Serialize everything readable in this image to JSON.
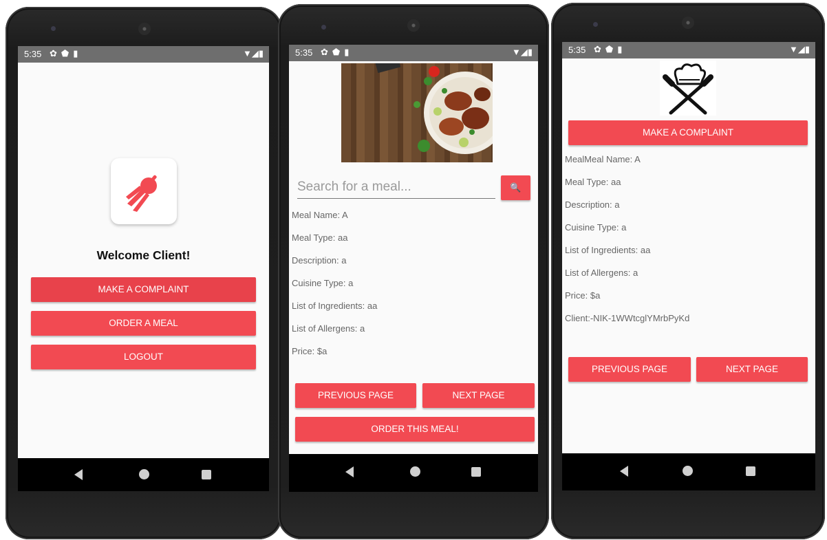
{
  "status": {
    "time": "5:35",
    "left_icons": [
      "gear-icon",
      "shield-icon",
      "sdcard-icon"
    ],
    "right_icons": [
      "wifi-icon",
      "signal-icon",
      "battery-icon"
    ]
  },
  "colors": {
    "accent": "#f24a52",
    "accent_dark": "#e8424b",
    "statusbar": "#6e6e6e",
    "screen_bg": "#fafafa"
  },
  "screen1": {
    "logo_icon": "delivery-rocket-icon",
    "welcome": "Welcome Client!",
    "buttons": {
      "complaint": "MAKE A COMPLAINT",
      "order": "ORDER A MEAL",
      "logout": "LOGOUT"
    }
  },
  "screen2": {
    "image_alt": "roasted chicken dish",
    "search": {
      "placeholder": "Search for a meal...",
      "icon": "search-icon"
    },
    "fields": [
      "Meal Name: A",
      "Meal Type: aa",
      " Description: a",
      " Cuisine Type: a",
      " List of Ingredients: aa",
      " List of Allergens: a",
      " Price: $a"
    ],
    "buttons": {
      "previous": "PREVIOUS PAGE",
      "next": "NEXT PAGE",
      "order": "ORDER THIS MEAL!"
    }
  },
  "screen3": {
    "logo_icon": "chef-hat-knives-icon",
    "buttons": {
      "complaint": "MAKE A COMPLAINT",
      "previous": "PREVIOUS PAGE",
      "next": "NEXT PAGE"
    },
    "fields": [
      "MealMeal Name: A",
      "Meal Type: aa",
      " Description: a",
      " Cuisine Type: a",
      " List of Ingredients: aa",
      " List of Allergens: a",
      " Price: $a",
      " Client:-NIK-1WWtcglYMrbPyKd"
    ]
  }
}
